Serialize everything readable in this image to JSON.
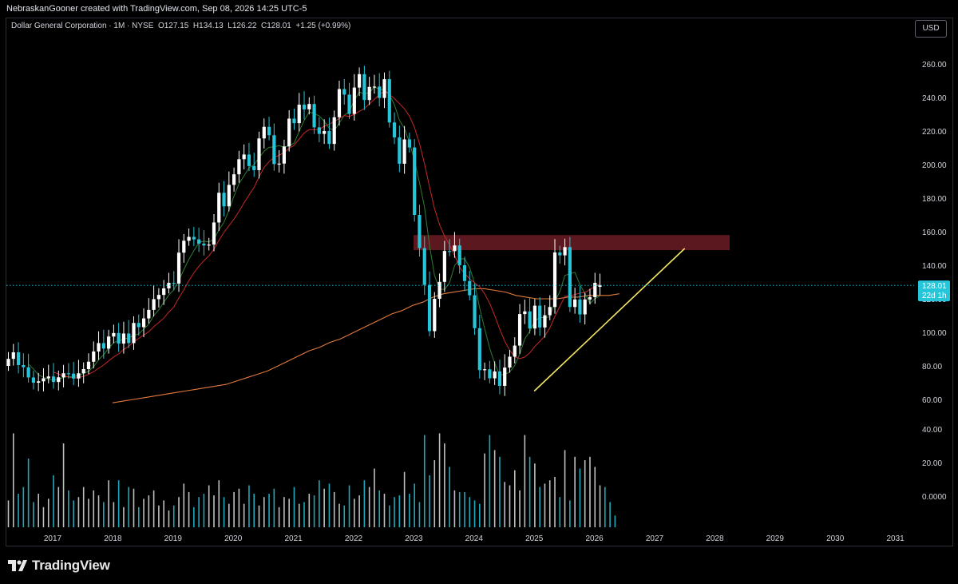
{
  "header": {
    "credit": "NebraskanGooner created with TradingView.com, Sep 08, 2026 14:25 UTC-5"
  },
  "legend": {
    "symbol": "Dollar General Corporation · 1M · NYSE",
    "o_label": "O",
    "o": "127.15",
    "h_label": "H",
    "h": "134.13",
    "l_label": "L",
    "l": "126.22",
    "c_label": "C",
    "c": "128.01",
    "change": "+1.25 (+0.99%)"
  },
  "currency_button": "USD",
  "price_tag": {
    "price": "128.01",
    "countdown": "22d 1h"
  },
  "brand": {
    "name": "TradingView"
  },
  "colors": {
    "up_body": "#ffffff",
    "down_body": "#26c6da",
    "ma_short": "#2e7d32",
    "ma_mid": "#c62828",
    "ma_long": "#e07a3c",
    "trendline": "#f5e663",
    "zone": "#6b1c24",
    "price_line": "#26c6da"
  },
  "chart_data": {
    "type": "candlestick",
    "title": "Dollar General Corporation · 1M · NYSE",
    "xlabel": "",
    "ylabel": "",
    "x_ticks": [
      "2017",
      "2018",
      "2019",
      "2020",
      "2021",
      "2022",
      "2023",
      "2024",
      "2025",
      "2026",
      "2027",
      "2028",
      "2029",
      "2030",
      "2031"
    ],
    "price_ticks": [
      "260.00",
      "240.00",
      "220.00",
      "200.00",
      "180.00",
      "160.00",
      "140.00",
      "120.00",
      "100.00",
      "80.00",
      "60.00"
    ],
    "volume_ticks": [
      "40.00",
      "20.00",
      "0.0000"
    ],
    "ylim": [
      55,
      268
    ],
    "last_close": 128.01,
    "closes": [
      84.2,
      88.1,
      80.5,
      79.2,
      73.1,
      70.0,
      70.8,
      72.6,
      73.7,
      70.4,
      73.2,
      75.6,
      75.4,
      72.5,
      75.6,
      78.1,
      82.5,
      88.6,
      93.6,
      90.3,
      97.5,
      99.6,
      93.3,
      99.3,
      93.6,
      105.6,
      103.1,
      108.3,
      113.4,
      119.8,
      122.3,
      126.2,
      129.5,
      129.1,
      147.5,
      154.6,
      156.9,
      155.4,
      152.9,
      151.8,
      152.3,
      165.5,
      183.2,
      175.1,
      187.9,
      194.2,
      203.2,
      206.0,
      199.1,
      196.7,
      215.6,
      222.5,
      217.5,
      200.3,
      200.6,
      210.8,
      227.4,
      224.7,
      235.7,
      232.9,
      236.1,
      222.2,
      218.3,
      220.0,
      212.3,
      228.2,
      245.0,
      241.7,
      230.2,
      245.9,
      253.9,
      238.5,
      246.3,
      246.5,
      239.7,
      250.9,
      225.1,
      216.2,
      200.5,
      215.0,
      210.2,
      170.0,
      150.2,
      128.3,
      100.7,
      120.0,
      130.1,
      148.5,
      148.4,
      151.8,
      140.0,
      130.6,
      122.1,
      102.5,
      77.5,
      78.0,
      72.6,
      76.7,
      68.1,
      79.0,
      85.5,
      92.1,
      110.9,
      112.5,
      102.3,
      115.9,
      102.9,
      110.2,
      115.1,
      147.6,
      145.9,
      150.8,
      115.1,
      119.6,
      110.7,
      119.6,
      121.0,
      129.5,
      128.01
    ],
    "opens": [
      80.0,
      84.2,
      88.1,
      80.5,
      79.2,
      73.1,
      70.0,
      70.8,
      72.6,
      73.7,
      70.4,
      73.2,
      75.6,
      75.4,
      72.5,
      75.6,
      78.1,
      82.5,
      88.6,
      93.6,
      90.3,
      97.5,
      99.6,
      93.3,
      99.3,
      93.6,
      105.6,
      103.1,
      108.3,
      113.4,
      119.8,
      122.3,
      126.2,
      129.5,
      129.1,
      147.5,
      154.6,
      156.9,
      155.4,
      152.9,
      151.8,
      152.3,
      165.5,
      183.2,
      175.1,
      187.9,
      194.2,
      203.2,
      206.0,
      199.1,
      196.7,
      215.6,
      222.5,
      217.5,
      200.3,
      200.6,
      210.8,
      227.4,
      224.7,
      235.7,
      232.9,
      236.1,
      222.2,
      218.3,
      220.0,
      212.3,
      228.2,
      245.0,
      241.7,
      230.2,
      245.9,
      253.9,
      238.5,
      246.3,
      246.5,
      239.7,
      250.9,
      225.1,
      216.2,
      200.5,
      215.0,
      210.2,
      170.0,
      150.2,
      128.3,
      100.7,
      120.0,
      130.1,
      148.5,
      148.4,
      151.8,
      140.0,
      130.6,
      122.1,
      102.5,
      77.5,
      78.0,
      72.6,
      76.7,
      68.1,
      79.0,
      85.5,
      92.1,
      110.9,
      112.5,
      102.3,
      115.9,
      102.9,
      110.2,
      115.1,
      147.6,
      145.9,
      150.8,
      115.1,
      119.6,
      110.7,
      119.6,
      121.0,
      127.15
    ],
    "ma_long_values": [
      58,
      59,
      60,
      61,
      62,
      63,
      64,
      65,
      66,
      67,
      68,
      69,
      71,
      73,
      75,
      77,
      80,
      83,
      86,
      89,
      91,
      94,
      96,
      99,
      102,
      105,
      108,
      111,
      113,
      116,
      118,
      121,
      123,
      124,
      125,
      126,
      126,
      125,
      124,
      122,
      121,
      120,
      120,
      120,
      121,
      121,
      122,
      122,
      122,
      123
    ],
    "volume": [
      16,
      56,
      20,
      24,
      41,
      15,
      20,
      12,
      17,
      31,
      24,
      50,
      22,
      16,
      18,
      24,
      17,
      22,
      19,
      15,
      28,
      15,
      28,
      12,
      24,
      23,
      12,
      17,
      19,
      22,
      13,
      16,
      10,
      13,
      18,
      26,
      21,
      12,
      18,
      20,
      25,
      19,
      28,
      18,
      14,
      21,
      23,
      14,
      25,
      20,
      13,
      18,
      20,
      23,
      12,
      18,
      17,
      24,
      14,
      15,
      20,
      19,
      28,
      23,
      26,
      21,
      14,
      13,
      25,
      17,
      19,
      28,
      24,
      35,
      22,
      20,
      13,
      18,
      19,
      33,
      20,
      26,
      15,
      55,
      31,
      40,
      56,
      50,
      36,
      22,
      21,
      21,
      18,
      16,
      14,
      44,
      55,
      46,
      42,
      27,
      25,
      34,
      22,
      55,
      42,
      38,
      24,
      26,
      28,
      30,
      18,
      46,
      16,
      42,
      35,
      40,
      42,
      36,
      25,
      24,
      15,
      7
    ],
    "resistance_zone": [
      149.0,
      158.0
    ],
    "trendline": {
      "from": [
        "2025",
        65
      ],
      "to": [
        "2027.5",
        150
      ]
    }
  }
}
